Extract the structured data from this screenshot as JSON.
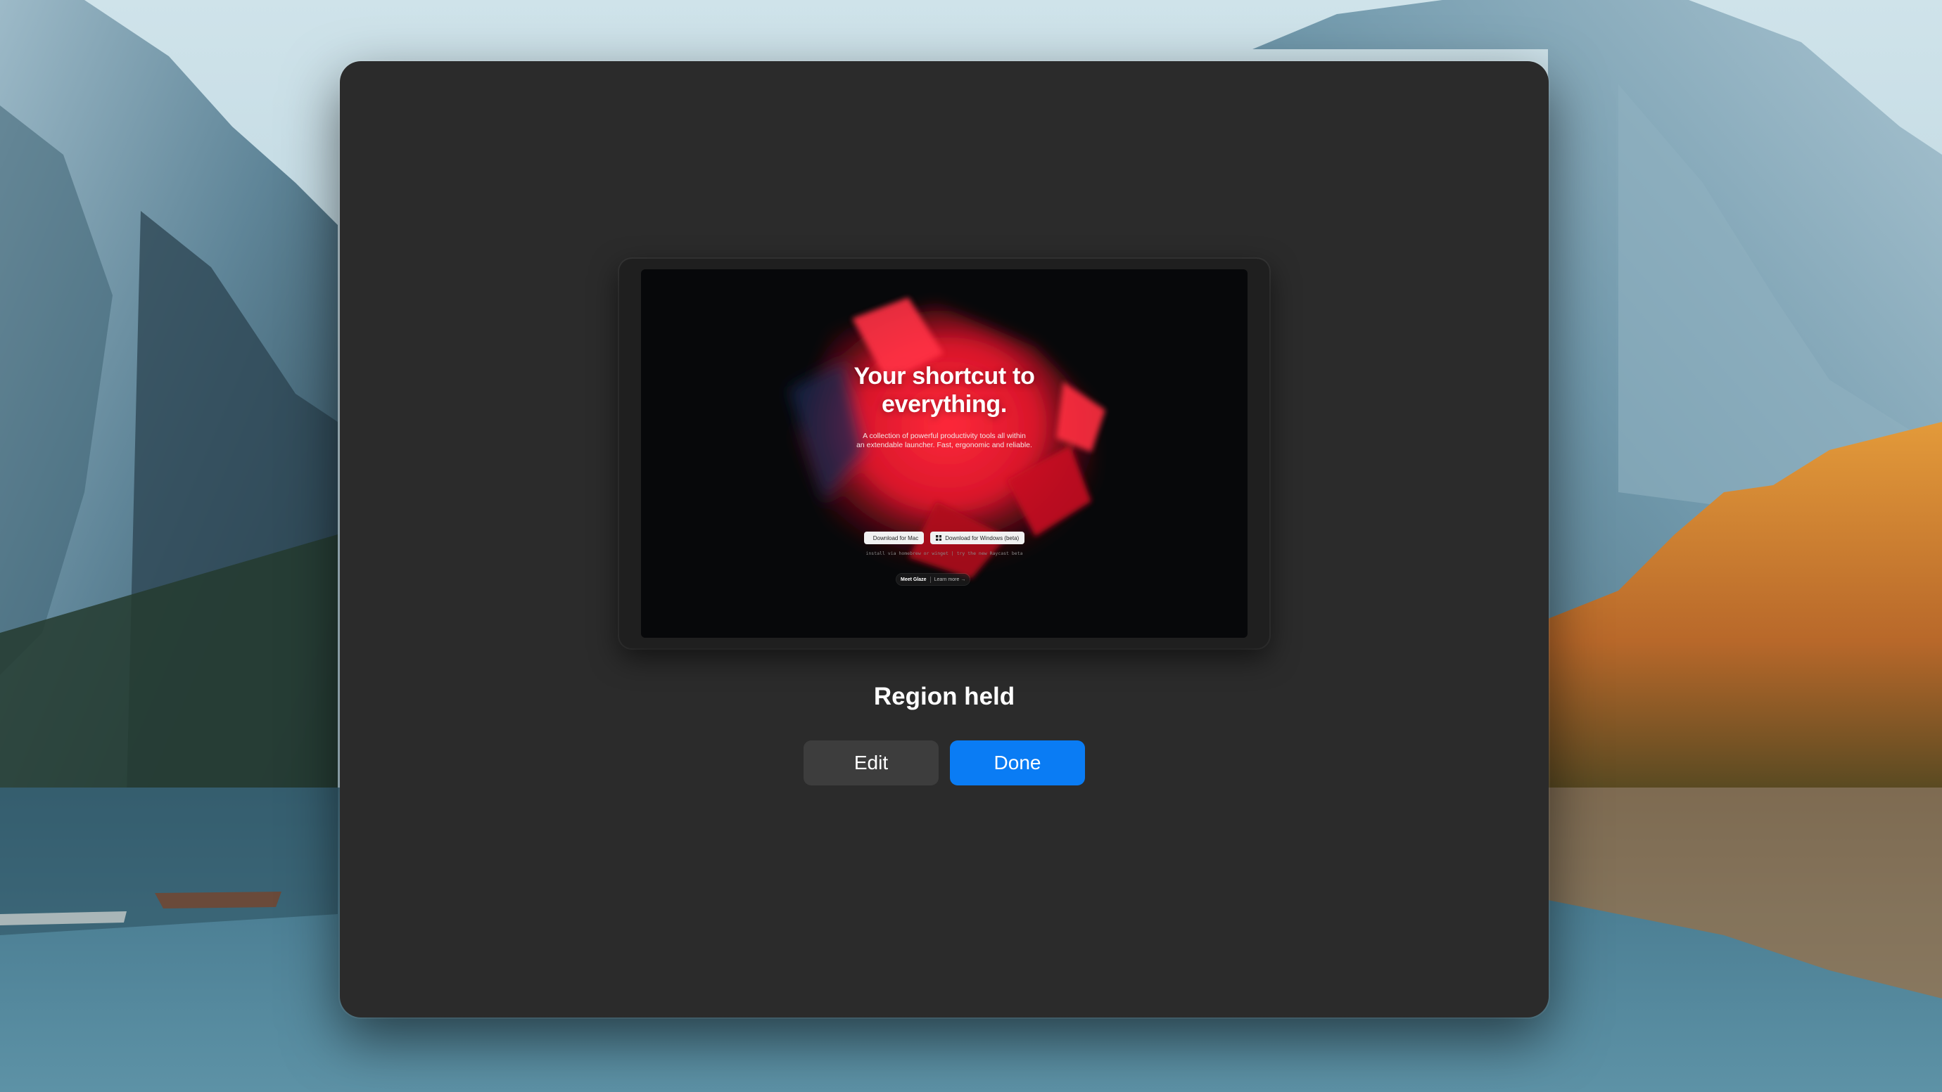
{
  "dialog": {
    "status_title": "Region held",
    "edit_label": "Edit",
    "done_label": "Done",
    "accent_color": "#0a7cf4"
  },
  "preview": {
    "title_line1": "Your shortcut to",
    "title_line2": "everything.",
    "subtitle_line1": "A collection of powerful productivity tools all within",
    "subtitle_line2": "an extendable launcher. Fast, ergonomic and reliable.",
    "download_mac_label": "Download for Mac",
    "download_windows_label": "Download for Windows (beta)",
    "install_hint": "install via homebrew or winget  |  try the new Raycast beta",
    "meet_label": "Meet Glaze",
    "learn_more_label": "Learn more →",
    "apple_icon": "apple-icon",
    "windows_icon": "windows-icon",
    "brand_color": "#e8202f"
  }
}
